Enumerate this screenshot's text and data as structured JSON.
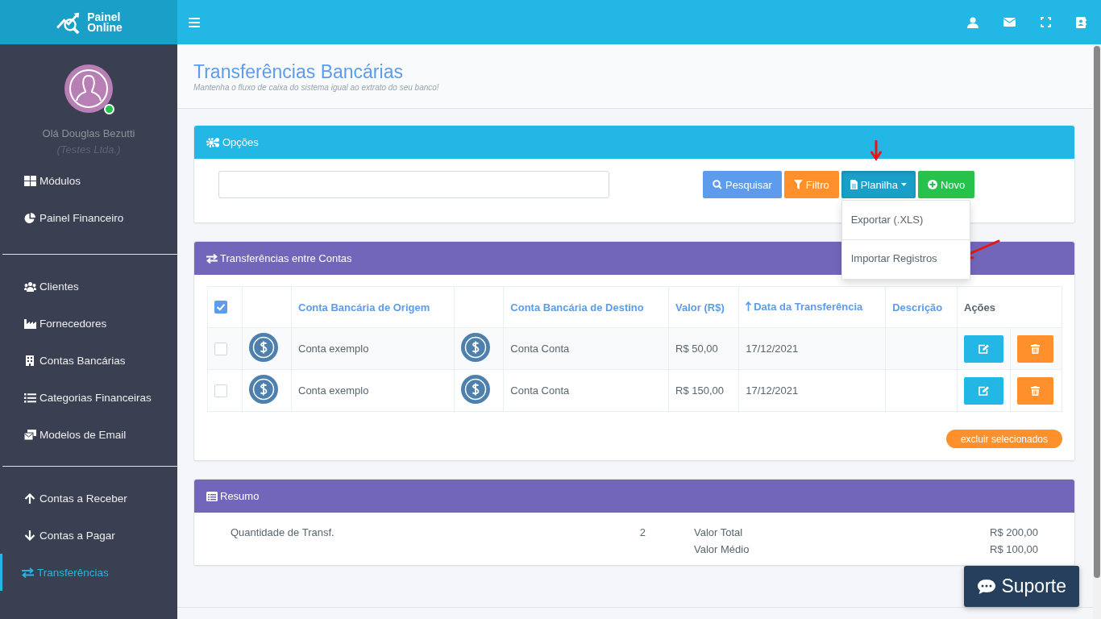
{
  "brand": {
    "line_1": "Painel",
    "line_2": "Online"
  },
  "user": {
    "greeting": "Olá Douglas Bezutti",
    "company": "(Testes Ltda.)",
    "online": true
  },
  "sidebar": {
    "groups": [
      [
        {
          "kind": "grid",
          "label": "Módulos",
          "selected": false
        },
        {
          "kind": "pie",
          "label": "Painel Financeiro",
          "selected": false
        }
      ],
      [
        {
          "kind": "users",
          "label": "Clientes",
          "selected": false
        },
        {
          "kind": "factory",
          "label": "Fornecedores",
          "selected": false
        },
        {
          "kind": "building",
          "label": "Contas Bancárias",
          "selected": false
        },
        {
          "kind": "list",
          "label": "Categorias Financeiras",
          "selected": false
        },
        {
          "kind": "mail",
          "label": "Modelos de Email",
          "selected": false
        }
      ],
      [
        {
          "kind": "up",
          "label": "Contas a Receber",
          "selected": false
        },
        {
          "kind": "down",
          "label": "Contas a Pagar",
          "selected": false
        },
        {
          "kind": "swap",
          "label": "Transferências",
          "selected": true
        }
      ]
    ]
  },
  "page": {
    "title": "Transferências Bancárias",
    "subtitle": "Mantenha o fluxo de caixa do sistema igual ao extrato do seu banco!"
  },
  "options_panel": {
    "title": "Opções",
    "buttons": [
      {
        "kind": "search",
        "label": "Pesquisar"
      },
      {
        "kind": "filter",
        "label": "Filtro"
      },
      {
        "kind": "sheet",
        "label": "Planilha",
        "expanded": true
      },
      {
        "kind": "new",
        "label": "Novo"
      }
    ],
    "menu": [
      "Exportar (.XLS)",
      "Importar Registros"
    ]
  },
  "transfers_panel": {
    "title": "Transferências entre Contas",
    "all_checked": true,
    "columns": [
      {
        "kind": "check"
      },
      {
        "kind": "icon"
      },
      {
        "kind": "link",
        "label": "Conta Bancária de Origem"
      },
      {
        "kind": "icon"
      },
      {
        "kind": "link",
        "label": "Conta Bancária de Destino"
      },
      {
        "kind": "link",
        "label": "Valor (R$)"
      },
      {
        "kind": "link",
        "label": "Data da Transferência",
        "sorted": true
      },
      {
        "kind": "link",
        "label": "Descrição"
      },
      {
        "kind": "plain",
        "label": "Ações"
      }
    ],
    "rows": [
      {
        "checked": false,
        "origin": "Conta exemplo",
        "destination": "Conta Conta",
        "amount": "R$ 50,00",
        "date": "17/12/2021"
      },
      {
        "checked": false,
        "origin": "Conta exemplo",
        "destination": "Conta Conta",
        "amount": "R$ 150,00",
        "date": "17/12/2021"
      }
    ],
    "delete_selected": "excluir selecionados"
  },
  "summary_panel": {
    "title": "Resumo",
    "count_label": "Quantidade de Transf.",
    "count": "2",
    "totals": [
      {
        "label": "Valor Total",
        "value": "R$ 200,00"
      },
      {
        "label": "Valor Médio",
        "value": "R$ 100,00"
      }
    ]
  },
  "support_button": "Suporte"
}
